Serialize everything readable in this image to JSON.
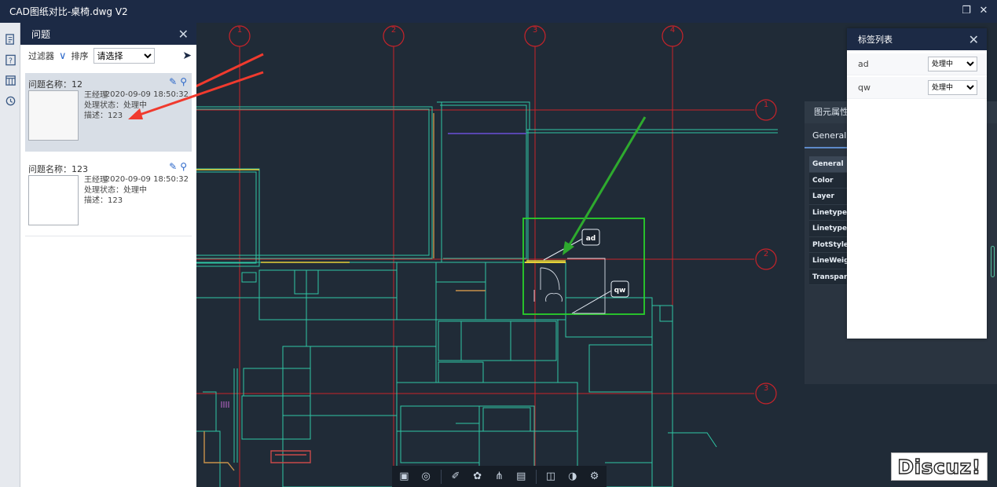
{
  "window": {
    "title": "CAD图纸对比-桌椅.dwg V2",
    "restore_icon": "restore-icon",
    "close_icon": "close-icon"
  },
  "left_rail": [
    {
      "icon": "sheet-icon"
    },
    {
      "icon": "question-icon"
    },
    {
      "icon": "panel-icon"
    },
    {
      "icon": "history-icon"
    }
  ],
  "issues_panel": {
    "title": "问题",
    "filter_label": "过滤器",
    "sort_label": "排序",
    "sort_placeholder": "请选择",
    "items": [
      {
        "name": "问题名称：12",
        "owner": "王经理",
        "date": "2020-09-09 18:50:32",
        "status": "处理状态：处理中",
        "desc": "描述：123"
      },
      {
        "name": "问题名称：123",
        "owner": "王经理",
        "date": "2020-09-09 18:50:32",
        "status": "处理状态：处理中",
        "desc": "描述：123"
      }
    ]
  },
  "drawing": {
    "grid_columns": [
      "1",
      "2",
      "3",
      "4"
    ],
    "grid_rows": [
      "1",
      "2",
      "3"
    ],
    "tags": [
      "ad",
      "qw"
    ],
    "colors": {
      "grid": "#d11f1f",
      "walls": "#2fc7a4",
      "highlight": "#2ad12a",
      "annotation_arrow_red": "#f03a2e",
      "annotation_arrow_green": "#2eaa2e"
    }
  },
  "properties_panel": {
    "title": "图元属性",
    "tab": "General",
    "rows": [
      "General",
      "Color",
      "Layer",
      "Linetype",
      "LinetypeScale",
      "PlotStyle",
      "LineWeight",
      "Transparency"
    ]
  },
  "tag_list": {
    "title": "标签列表",
    "rows": [
      {
        "name": "ad",
        "status": "处理中"
      },
      {
        "name": "qw",
        "status": "处理中"
      }
    ]
  },
  "bottom_toolbar": [
    {
      "icon": "layout-icon"
    },
    {
      "icon": "orbit-icon"
    },
    {
      "icon": "measure-icon"
    },
    {
      "icon": "palette-icon"
    },
    {
      "icon": "tree-icon"
    },
    {
      "icon": "properties-icon"
    },
    {
      "icon": "layers-icon"
    },
    {
      "icon": "render-icon"
    },
    {
      "icon": "settings-icon"
    }
  ],
  "watermark": "Discuz!"
}
